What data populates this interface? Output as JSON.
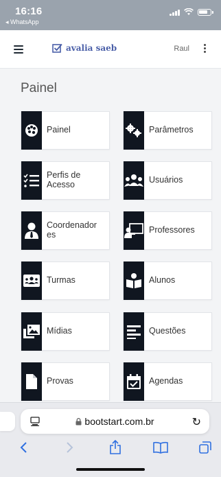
{
  "status_bar": {
    "time": "16:16",
    "back_app": "◂ WhatsApp"
  },
  "header": {
    "brand": "avalia saeb",
    "user": "Raul"
  },
  "page": {
    "title": "Painel"
  },
  "menu": [
    {
      "label": "Painel",
      "icon": "palette-icon"
    },
    {
      "label": "Parâmetros",
      "icon": "gears-icon"
    },
    {
      "label": "Perfis de\nAcesso",
      "icon": "list-check-icon"
    },
    {
      "label": "Usuários",
      "icon": "users-icon"
    },
    {
      "label": "Coordenador\nes",
      "icon": "user-tie-icon"
    },
    {
      "label": "Professores",
      "icon": "chalkboard-teacher-icon"
    },
    {
      "label": "Turmas",
      "icon": "class-group-icon"
    },
    {
      "label": "Alunos",
      "icon": "student-reading-icon"
    },
    {
      "label": "Mídias",
      "icon": "media-photos-icon"
    },
    {
      "label": "Questões",
      "icon": "align-left-icon"
    },
    {
      "label": "Provas",
      "icon": "document-icon"
    },
    {
      "label": "Agendas",
      "icon": "calendar-check-icon"
    }
  ],
  "browser": {
    "url": "bootstart.com.br"
  },
  "colors": {
    "accent": "#2f6fe0",
    "brand": "#4a5fa8",
    "icon_bg": "#101620"
  }
}
